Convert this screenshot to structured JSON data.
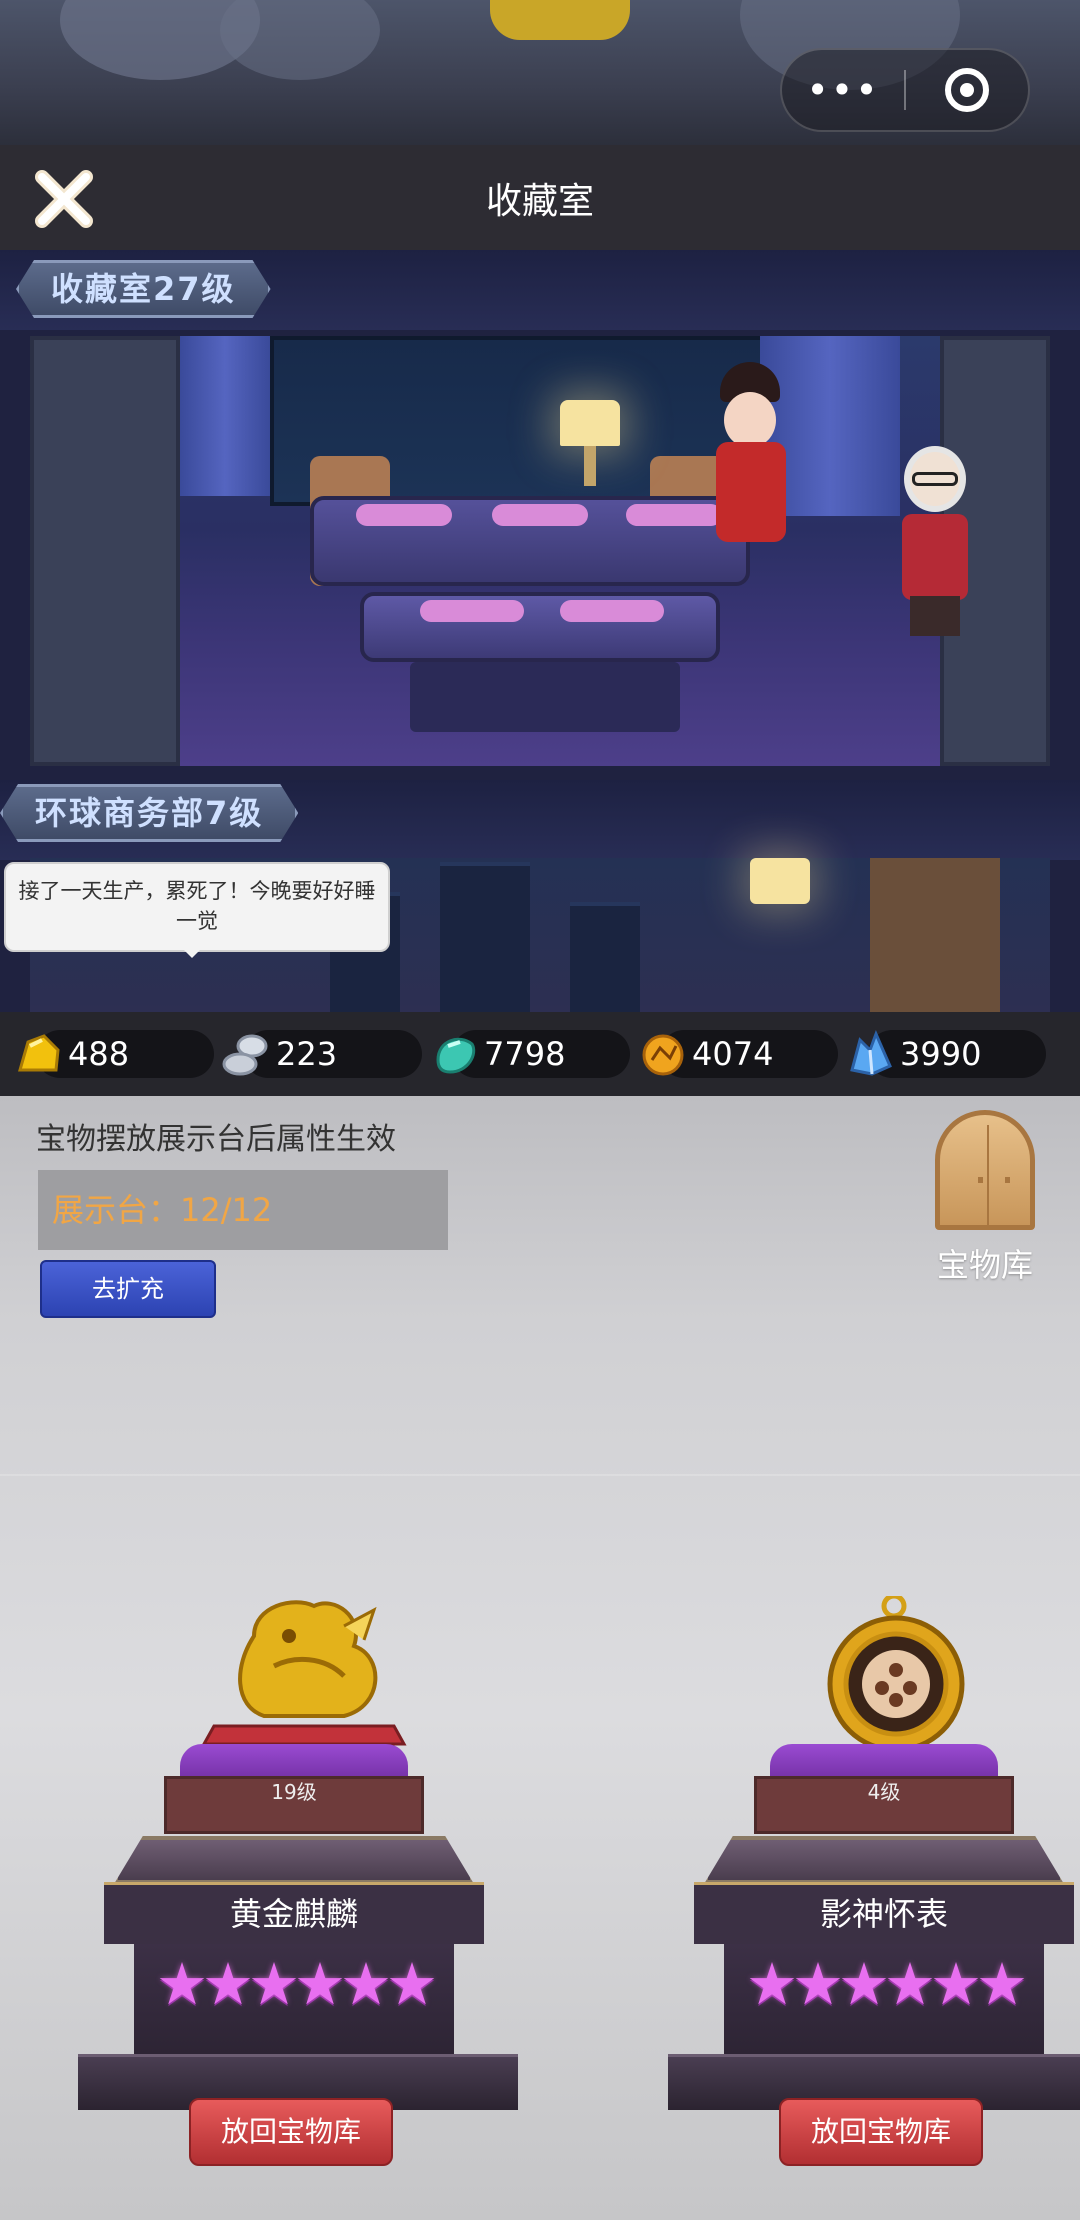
{
  "nav": {
    "title": "收藏室",
    "menu_dots": "•••"
  },
  "scene": {
    "room1_label": "收藏室27级",
    "room2_label": "环球商务部7级",
    "speech": "接了一天生产，累死了！今晚要好好睡一觉"
  },
  "resources": [
    {
      "icon": "gold-ore-icon",
      "value": "488"
    },
    {
      "icon": "silver-ore-icon",
      "value": "223"
    },
    {
      "icon": "jade-icon",
      "value": "7798"
    },
    {
      "icon": "amber-icon",
      "value": "4074"
    },
    {
      "icon": "crystal-icon",
      "value": "3990"
    }
  ],
  "panel": {
    "hint": "宝物摆放展示台后属性生效",
    "stand_label": "展示台：",
    "stand_count": "12/12",
    "expand_button": "去扩充",
    "vault_label": "宝物库"
  },
  "treasures": [
    {
      "name": "黄金麒麟",
      "level": "19级",
      "stars": "★★★★★★",
      "star_count": 6,
      "button": "放回宝物库",
      "icon": "golden-qilin-icon"
    },
    {
      "name": "影神怀表",
      "level": "4级",
      "stars": "★★★★★★",
      "star_count": 6,
      "button": "放回宝物库",
      "icon": "pocket-watch-icon"
    }
  ],
  "colors": {
    "accent_blue": "#3a52c8",
    "button_red": "#d64848",
    "star_pink": "#e86ff0",
    "stand_orange": "#f1a645"
  }
}
